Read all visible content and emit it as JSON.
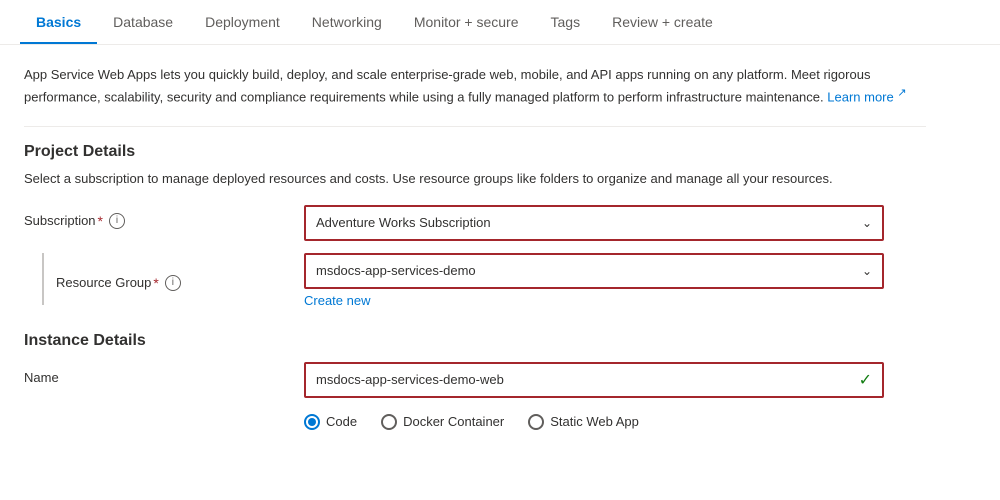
{
  "tabs": [
    {
      "id": "basics",
      "label": "Basics",
      "active": true
    },
    {
      "id": "database",
      "label": "Database",
      "active": false
    },
    {
      "id": "deployment",
      "label": "Deployment",
      "active": false
    },
    {
      "id": "networking",
      "label": "Networking",
      "active": false
    },
    {
      "id": "monitor",
      "label": "Monitor + secure",
      "active": false
    },
    {
      "id": "tags",
      "label": "Tags",
      "active": false
    },
    {
      "id": "review",
      "label": "Review + create",
      "active": false
    }
  ],
  "description": {
    "text": "App Service Web Apps lets you quickly build, deploy, and scale enterprise-grade web, mobile, and API apps running on any platform. Meet rigorous performance, scalability, security and compliance requirements while using a fully managed platform to perform infrastructure maintenance.",
    "learn_more_label": "Learn more",
    "learn_more_url": "#"
  },
  "project_details": {
    "heading": "Project Details",
    "description": "Select a subscription to manage deployed resources and costs. Use resource groups like folders to organize and manage all your resources.",
    "subscription": {
      "label": "Subscription",
      "required": true,
      "value": "Adventure Works Subscription",
      "info_icon": "i"
    },
    "resource_group": {
      "label": "Resource Group",
      "required": true,
      "value": "msdocs-app-services-demo",
      "info_icon": "i",
      "create_new_label": "Create new"
    }
  },
  "instance_details": {
    "heading": "Instance Details",
    "name": {
      "label": "Name",
      "value": "msdocs-app-services-demo-web"
    },
    "publish_options": [
      {
        "label": "Code",
        "selected": true
      },
      {
        "label": "Docker Container",
        "selected": false
      },
      {
        "label": "Static Web App",
        "selected": false
      }
    ]
  },
  "icons": {
    "chevron_down": "⌄",
    "external_link": "↗",
    "check": "✓"
  }
}
